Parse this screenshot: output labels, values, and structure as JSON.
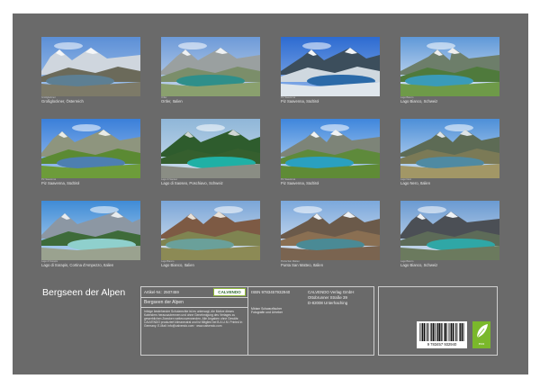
{
  "colors": {
    "page_bg": "#6a6a6a",
    "caption": "#e8e8e8",
    "eco_green": "#7ab82b"
  },
  "photos": [
    {
      "caption": "Großglockner, Österreich",
      "tiny": "Großglockner",
      "scene": "mountain-lake"
    },
    {
      "caption": "Ortler, Italien",
      "tiny": "Ortler",
      "scene": "alpine-pond"
    },
    {
      "caption": "Piz Saavenna, Südtirol",
      "tiny": "Piz Saavenna",
      "scene": "snowy-lake"
    },
    {
      "caption": "Lago Bianco, Schweiz",
      "tiny": "Lago Bianco",
      "scene": "cloudy-lake"
    },
    {
      "caption": "Piz Saavenna, Südtirol",
      "tiny": "Piz Saavenna",
      "scene": "green-slope"
    },
    {
      "caption": "Lago di Saoseo, Poschiavo, Schweiz",
      "tiny": "Lago di Saoseo",
      "scene": "turquoise-forest"
    },
    {
      "caption": "Piz Saavenna, Südtirol",
      "tiny": "Piz Saavenna",
      "scene": "blue-lake-valley"
    },
    {
      "caption": "Lago Nero, Italien",
      "tiny": "Lago Nero",
      "scene": "dark-lake"
    },
    {
      "caption": "Lago di Sorapis, Cortina d'Ampezzo, Italien",
      "tiny": "Lago di Sorapis",
      "scene": "milky-lake"
    },
    {
      "caption": "Lago Bianco, Italien",
      "tiny": "Lago Bianco",
      "scene": "brown-peak"
    },
    {
      "caption": "Punta San Matteo, Italien",
      "tiny": "Punta San Matteo",
      "scene": "rocky-lake"
    },
    {
      "caption": "Lago Bianco, Schweiz",
      "tiny": "Lago Bianco",
      "scene": "glacier-lake"
    }
  ],
  "calendar": {
    "title": "Bergseen der Alpen",
    "article_no": "Artikel-Nr.: 2507459",
    "isbn": "ISBN 9783457932940",
    "brand": "CALVENDO",
    "subtitle": "Bergseen der Alpen",
    "author": "Miriam Schwarzfischer Fotografin und Urheber",
    "publisher_1": "CALVENDO Verlag GmbH",
    "publisher_2": "Ottobrunner Straße 39",
    "publisher_3": "D-82008 Unterhaching",
    "blurb": "Infolge bestehender Schutzrechte ist es untersagt, die Motive dieses Kalenders herauszutrennen und ohne Genehmigung des Verlages zu gewerblichen Zwecken weiterzuverwenden. Alle Angaben ohne Gewähr. CALVENDO produziert klimaneutral und ist Mitglied bei B.A.U.M. Printed in Germany. E-Mail: info@calvendo.com · www.calvendo.com",
    "barcode_number": "9 783457 932940",
    "eco_label": "eco"
  }
}
